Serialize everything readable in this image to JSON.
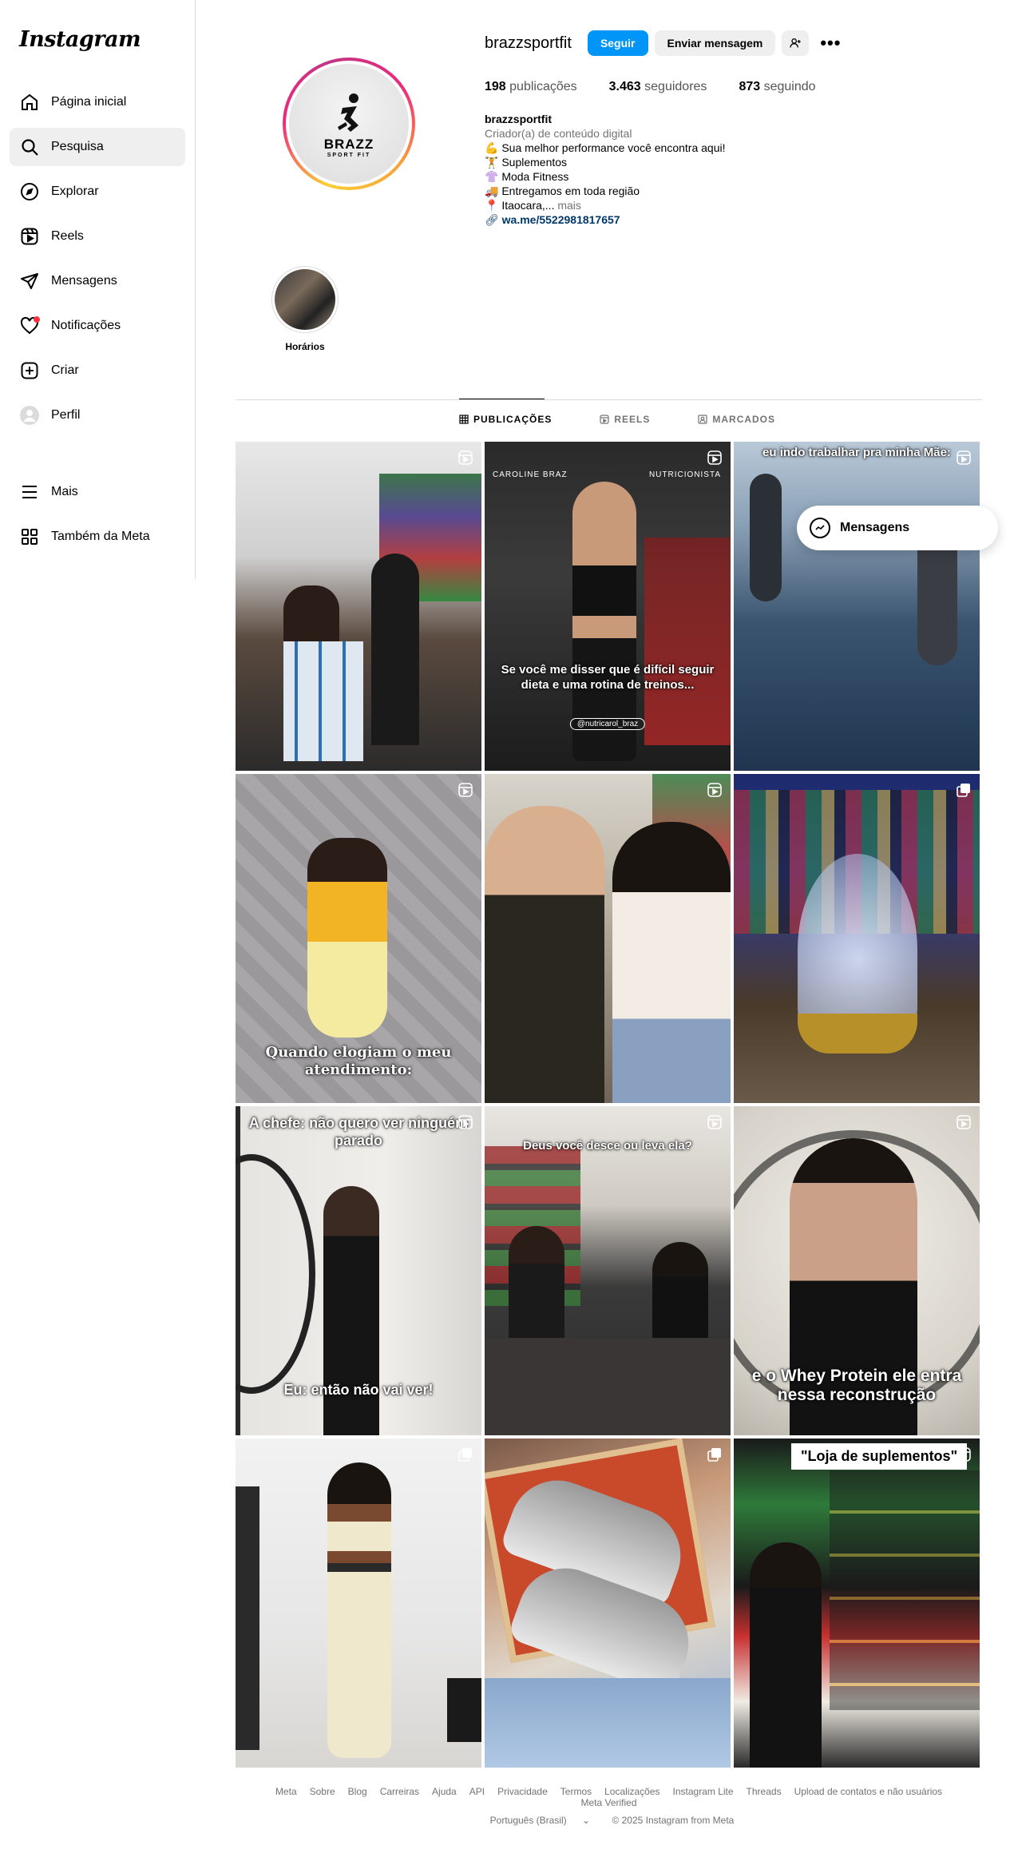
{
  "app": {
    "logo": "Instagram"
  },
  "sidebar": {
    "items": [
      {
        "label": "Página inicial",
        "icon": "home-icon"
      },
      {
        "label": "Pesquisa",
        "icon": "search-icon"
      },
      {
        "label": "Explorar",
        "icon": "compass-icon"
      },
      {
        "label": "Reels",
        "icon": "reels-icon"
      },
      {
        "label": "Mensagens",
        "icon": "send-icon"
      },
      {
        "label": "Notificações",
        "icon": "heart-icon"
      },
      {
        "label": "Criar",
        "icon": "plus-square-icon"
      },
      {
        "label": "Perfil",
        "icon": "avatar-icon"
      }
    ],
    "bottom": [
      {
        "label": "Mais",
        "icon": "menu-icon"
      },
      {
        "label": "Também da Meta",
        "icon": "grid-icon"
      }
    ]
  },
  "profile": {
    "username": "brazzsportfit",
    "follow_label": "Seguir",
    "message_label": "Enviar mensagem",
    "avatar_brand": "BRAZZ",
    "avatar_brand_sub": "SPORT FIT",
    "stats": {
      "posts_count": "198",
      "posts_label": "publicações",
      "followers_count": "3.463",
      "followers_label": "seguidores",
      "following_count": "873",
      "following_label": "seguindo"
    },
    "bio": {
      "name": "brazzsportfit",
      "category": "Criador(a) de conteúdo digital",
      "lines": [
        "💪 Sua melhor performance você encontra aqui!",
        "🏋 Suplementos",
        "👚 Moda Fitness",
        "🚚 Entregamos em toda região",
        "📍 Itaocara,..."
      ],
      "more": "mais",
      "link": "wa.me/5522981817657"
    },
    "highlight": {
      "label": "Horários"
    }
  },
  "tabs": [
    {
      "label": "PUBLICAÇÕES",
      "icon": "grid-icon"
    },
    {
      "label": "REELS",
      "icon": "reels-icon"
    },
    {
      "label": "MARCADOS",
      "icon": "tag-icon"
    }
  ],
  "posts": [
    {
      "caption": "",
      "type": "reel"
    },
    {
      "caption": "Se você me disser que é difícil seguir dieta e uma rotina de treinos...",
      "top_left": "CAROLINE BRAZ",
      "top_right": "NUTRICIONISTA",
      "handle": "@nutricarol_braz",
      "type": "reel"
    },
    {
      "caption": "eu indo trabalhar pra minha Mãe:",
      "type": "reel"
    },
    {
      "caption": "Quando elogiam o meu atendimento:",
      "type": "reel"
    },
    {
      "caption": "",
      "type": "reel"
    },
    {
      "caption": "",
      "type": "carousel"
    },
    {
      "caption_top": "A chefe: não quero ver ninguém parado",
      "caption": "Eu: então não vai ver!",
      "type": "reel"
    },
    {
      "caption": "Deus você desce ou leva ela?",
      "type": "reel"
    },
    {
      "caption": "e o Whey Protein ele entra nessa reconstrução",
      "type": "reel"
    },
    {
      "caption": "",
      "type": "carousel"
    },
    {
      "caption": "",
      "type": "carousel"
    },
    {
      "caption": "\"Loja de suplementos\"",
      "type": "reel"
    }
  ],
  "floating_messages": {
    "label": "Mensagens"
  },
  "footer": {
    "links": [
      "Meta",
      "Sobre",
      "Blog",
      "Carreiras",
      "Ajuda",
      "API",
      "Privacidade",
      "Termos",
      "Localizações",
      "Instagram Lite",
      "Threads",
      "Upload de contatos e não usuários",
      "Meta Verified"
    ],
    "language": "Português (Brasil)",
    "copyright": "© 2025 Instagram from Meta"
  }
}
